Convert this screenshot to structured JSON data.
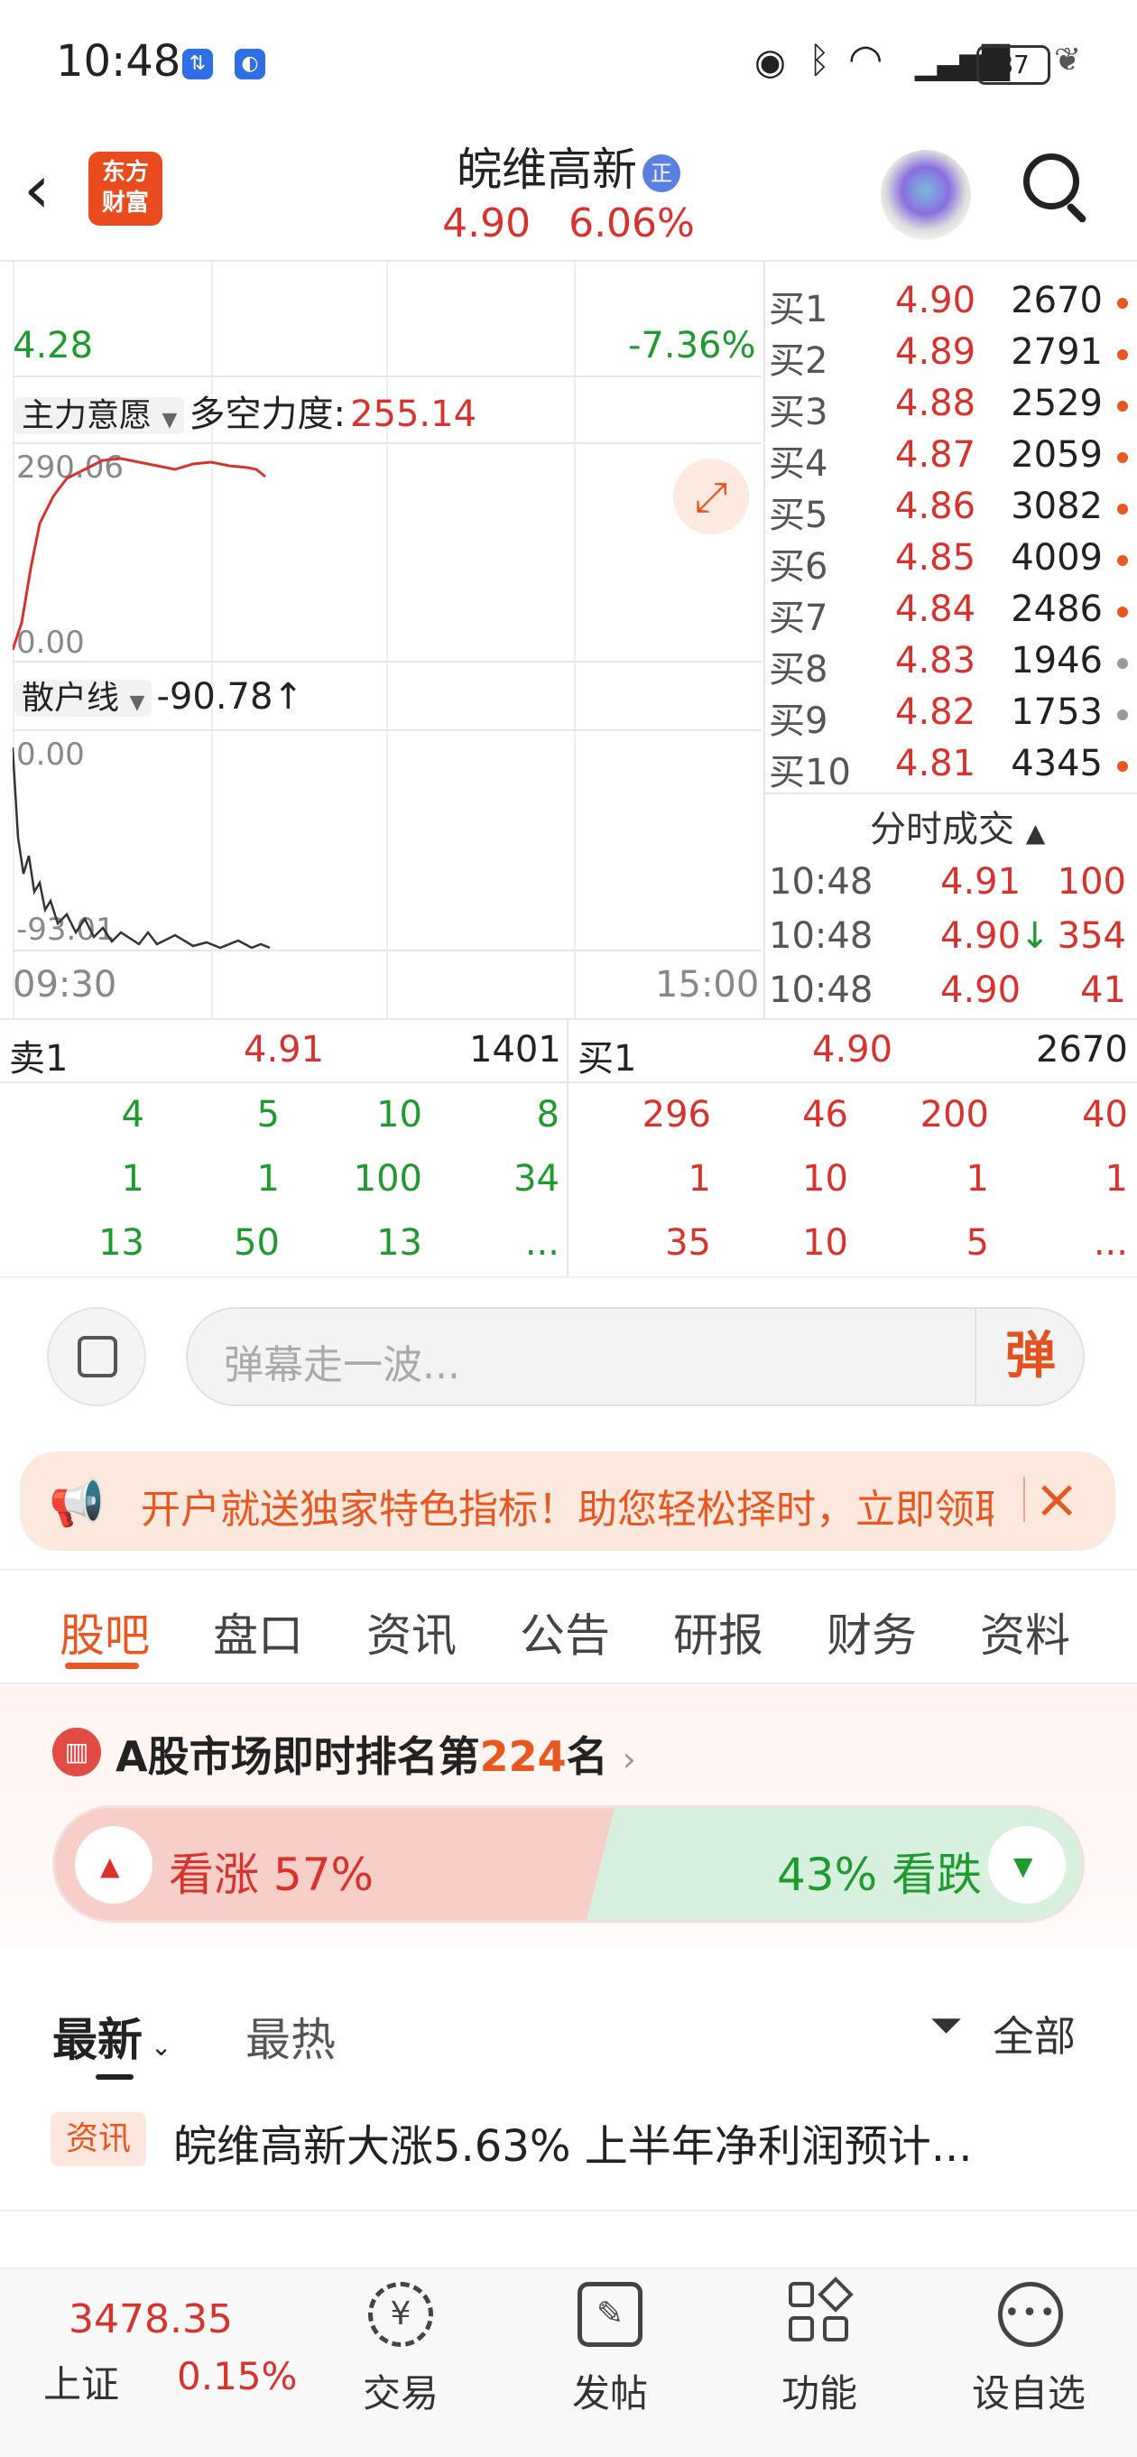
{
  "status_bar": {
    "time": "10:48",
    "battery": "87"
  },
  "header": {
    "back_label": "<",
    "logo_line1": "东方",
    "logo_line2": "财富",
    "stock_name": "皖维高新",
    "badge": "正",
    "price": "4.90",
    "change_pct": "6.06%"
  },
  "chart": {
    "price_low": "4.28",
    "pct_low": "-7.36%",
    "indicator1_label": "主力意愿",
    "indicator1_name": "多空力度:",
    "indicator1_value": "255.14",
    "ind1_top": "290.06",
    "ind1_bottom": "0.00",
    "indicator2_label": "散户线",
    "indicator2_value": "-90.78",
    "indicator2_arrow": "↑",
    "ind2_top": "0.00",
    "ind2_bottom": "-93.01",
    "time_start": "09:30",
    "time_end": "15:00"
  },
  "order_book": [
    {
      "label": "买1",
      "price": "4.90",
      "vol": "2670",
      "dot": "#e9561f"
    },
    {
      "label": "买2",
      "price": "4.89",
      "vol": "2791",
      "dot": "#e9561f"
    },
    {
      "label": "买3",
      "price": "4.88",
      "vol": "2529",
      "dot": "#e9561f"
    },
    {
      "label": "买4",
      "price": "4.87",
      "vol": "2059",
      "dot": "#e9561f"
    },
    {
      "label": "买5",
      "price": "4.86",
      "vol": "3082",
      "dot": "#e9561f"
    },
    {
      "label": "买6",
      "price": "4.85",
      "vol": "4009",
      "dot": "#e9561f"
    },
    {
      "label": "买7",
      "price": "4.84",
      "vol": "2486",
      "dot": "#e9561f"
    },
    {
      "label": "买8",
      "price": "4.83",
      "vol": "1946",
      "dot": "#999999"
    },
    {
      "label": "买9",
      "price": "4.82",
      "vol": "1753",
      "dot": "#999999"
    },
    {
      "label": "买10",
      "price": "4.81",
      "vol": "4345",
      "dot": "#e9561f"
    }
  ],
  "trades": {
    "title": "分时成交",
    "rows": [
      {
        "time": "10:48",
        "price": "4.91",
        "arrow": "",
        "vol": "100"
      },
      {
        "time": "10:48",
        "price": "4.90",
        "arrow": "↓",
        "vol": "354"
      },
      {
        "time": "10:48",
        "price": "4.90",
        "arrow": "",
        "vol": "41"
      }
    ]
  },
  "depth": {
    "left_label": "卖1",
    "left_price": "4.91",
    "left_vol": "1401",
    "right_label": "买1",
    "right_price": "4.90",
    "right_vol": "2670",
    "left_rows": [
      [
        "4",
        "5",
        "10",
        "8"
      ],
      [
        "1",
        "1",
        "100",
        "34"
      ],
      [
        "13",
        "50",
        "13",
        "..."
      ]
    ],
    "right_rows": [
      [
        "296",
        "46",
        "200",
        "40"
      ],
      [
        "1",
        "10",
        "1",
        "1"
      ],
      [
        "35",
        "10",
        "5",
        "..."
      ]
    ]
  },
  "danmu": {
    "placeholder": "弹幕走一波...",
    "send": "弹"
  },
  "promo": {
    "text": "开户就送独家特色指标！助您轻松择时，立即领取"
  },
  "tabs": [
    "股吧",
    "盘口",
    "资讯",
    "公告",
    "研报",
    "财务",
    "资料"
  ],
  "rank": {
    "prefix": "A股市场即时排名第",
    "number": "224",
    "suffix": "名"
  },
  "vote": {
    "up": "看涨 57%",
    "down": "43% 看跌"
  },
  "feed": {
    "sort_latest": "最新",
    "sort_hot": "最热",
    "filter": "全部"
  },
  "news": {
    "tag": "资讯",
    "title": "皖维高新大涨5.63% 上半年净利润预计..."
  },
  "bottom_bar": {
    "index_value": "3478.35",
    "index_name": "上证",
    "index_pct": "0.15%",
    "items": [
      "交易",
      "发帖",
      "功能",
      "设自选"
    ]
  }
}
